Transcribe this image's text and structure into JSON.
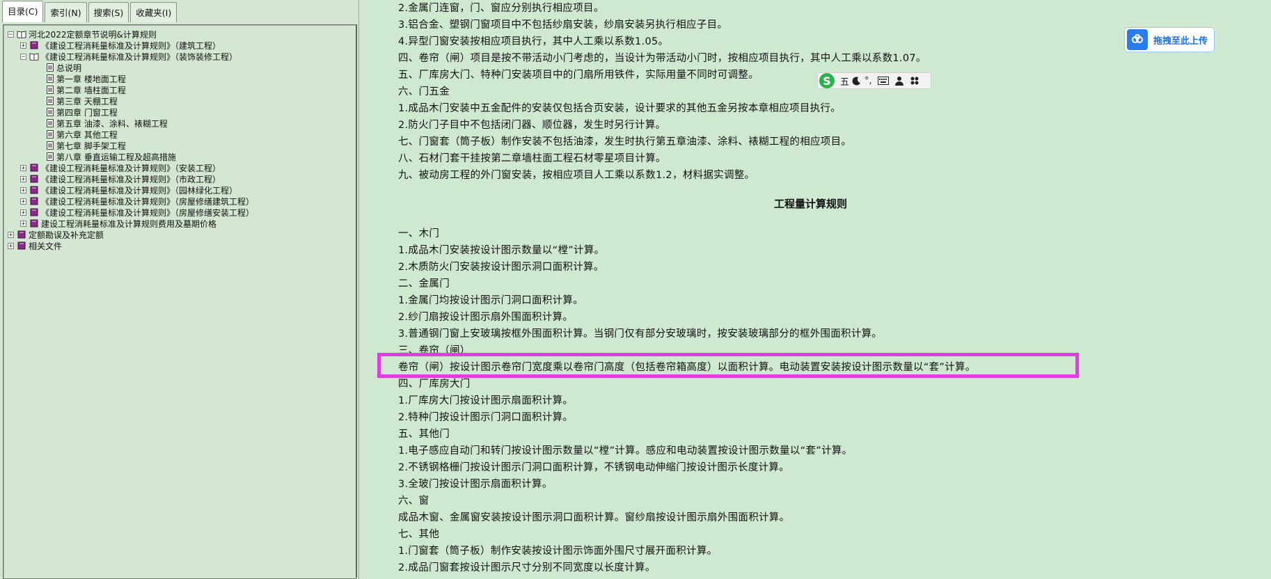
{
  "tabs": [
    {
      "label": "目录(C)"
    },
    {
      "label": "索引(N)"
    },
    {
      "label": "搜索(S)"
    },
    {
      "label": "收藏夹(I)"
    }
  ],
  "tree": [
    {
      "label": "河北2022定额章节说明&计算规则",
      "expander": "−",
      "icon": "book-open-icon"
    },
    {
      "label": "《建设工程消耗量标准及计算规则》（建筑工程）",
      "expander": "+",
      "icon": "book-icon"
    },
    {
      "label": "《建设工程消耗量标准及计算规则》（装饰装修工程）",
      "expander": "−",
      "icon": "book-open-icon"
    },
    {
      "label": "总说明",
      "icon": "page-icon"
    },
    {
      "label": "第一章 楼地面工程",
      "icon": "page-icon"
    },
    {
      "label": "第二章 墙柱面工程",
      "icon": "page-icon"
    },
    {
      "label": "第三章 天棚工程",
      "icon": "page-icon"
    },
    {
      "label": "第四章 门窗工程",
      "icon": "page-icon"
    },
    {
      "label": "第五章 油漆、涂料、裱糊工程",
      "icon": "page-icon"
    },
    {
      "label": "第六章 其他工程",
      "icon": "page-icon"
    },
    {
      "label": "第七章 脚手架工程",
      "icon": "page-icon"
    },
    {
      "label": "第八章 垂直运输工程及超高措施",
      "icon": "page-icon"
    },
    {
      "label": "《建设工程消耗量标准及计算规则》（安装工程）",
      "expander": "+",
      "icon": "book-icon"
    },
    {
      "label": "《建设工程消耗量标准及计算规则》（市政工程）",
      "expander": "+",
      "icon": "book-icon"
    },
    {
      "label": "《建设工程消耗量标准及计算规则》（园林绿化工程）",
      "expander": "+",
      "icon": "book-icon"
    },
    {
      "label": "《建设工程消耗量标准及计算规则》（房屋修缮建筑工程）",
      "expander": "+",
      "icon": "book-icon"
    },
    {
      "label": "《建设工程消耗量标准及计算规则》（房屋修缮安装工程）",
      "expander": "+",
      "icon": "book-icon"
    },
    {
      "label": "建设工程消耗量标准及计算规则费用及墓期价格",
      "expander": "+",
      "icon": "book-icon"
    },
    {
      "label": "定额勘误及补充定额",
      "expander": "+",
      "icon": "book-icon"
    },
    {
      "label": "相关文件",
      "expander": "+",
      "icon": "book-icon"
    }
  ],
  "document": {
    "lines": [
      "2.金属门连窗，门、窗应分别执行相应项目。",
      "3.铝合金、塑钢门窗项目中不包括纱扇安装，纱扇安装另执行相应子目。",
      "4.异型门窗安装按相应项目执行，其中人工乘以系数1.05。",
      "四、卷帘（闸）项目是按不带活动小门考虑的，当设计为带活动小门时，按相应项目执行，其中人工乘以系数1.07。",
      "五、厂库房大门、特种门安装项目中的门扇所用铁件，实际用量不同时可调整。",
      "六、门五金",
      "1.成品木门安装中五金配件的安装仅包括合页安装，设计要求的其他五金另按本章相应项目执行。",
      "2.防火门子目中不包括闭门器、顺位器，发生时另行计算。",
      "七、门窗套（筒子板）制作安装不包括油漆，发生时执行第五章油漆、涂料、裱糊工程的相应项目。",
      "八、石材门套干挂按第二章墙柱面工程石材零星项目计算。",
      "九、被动房工程的外门窗安装，按相应项目人工乘以系数1.2，材料据实调整。"
    ],
    "heading": "工程量计算规则",
    "rules": [
      "一、木门",
      "1.成品木门安装按设计图示数量以“樘”计算。",
      "2.木质防火门安装按设计图示洞口面积计算。",
      "二、金属门",
      "1.金属门均按设计图示门洞口面积计算。",
      "2.纱门扇按设计图示扇外围面积计算。",
      "3.普通钢门窗上安玻璃按框外围面积计算。当钢门仅有部分安玻璃时，按安装玻璃部分的框外围面积计算。",
      "三、卷帘（闸）",
      "卷帘（闸）按设计图示卷帘门宽度乘以卷帘门高度（包括卷帘箱高度）以面积计算。电动装置安装按设计图示数量以“套”计算。",
      "四、厂库房大门",
      "1.厂库房大门按设计图示扇面积计算。",
      "2.特种门按设计图示门洞口面积计算。",
      "五、其他门",
      "1.电子感应自动门和转门按设计图示数量以“樘”计算。感应和电动装置按设计图示数量以“套”计算。",
      "2.不锈钢格栅门按设计图示门洞口面积计算，不锈钢电动伸缩门按设计图示长度计算。",
      "3.全玻门按设计图示扇面积计算。",
      "六、窗",
      "成品木窗、金属窗安装按设计图示洞口面积计算。窗纱扇按设计图示扇外围面积计算。",
      "七、其他",
      "1.门窗套（筒子板）制作安装按设计图示饰面外围尺寸展开面积计算。",
      "2.成品门窗套按设计图示尺寸分别不同宽度以长度计算。"
    ]
  },
  "upload": {
    "label": "拖拽至此上传"
  },
  "ime": {
    "logo": "S",
    "mode": "五",
    "punct": "°,"
  },
  "colors": {
    "highlight": "#e03ce0",
    "background": "#cfe8d0",
    "upload_blue": "#2a7cec"
  }
}
